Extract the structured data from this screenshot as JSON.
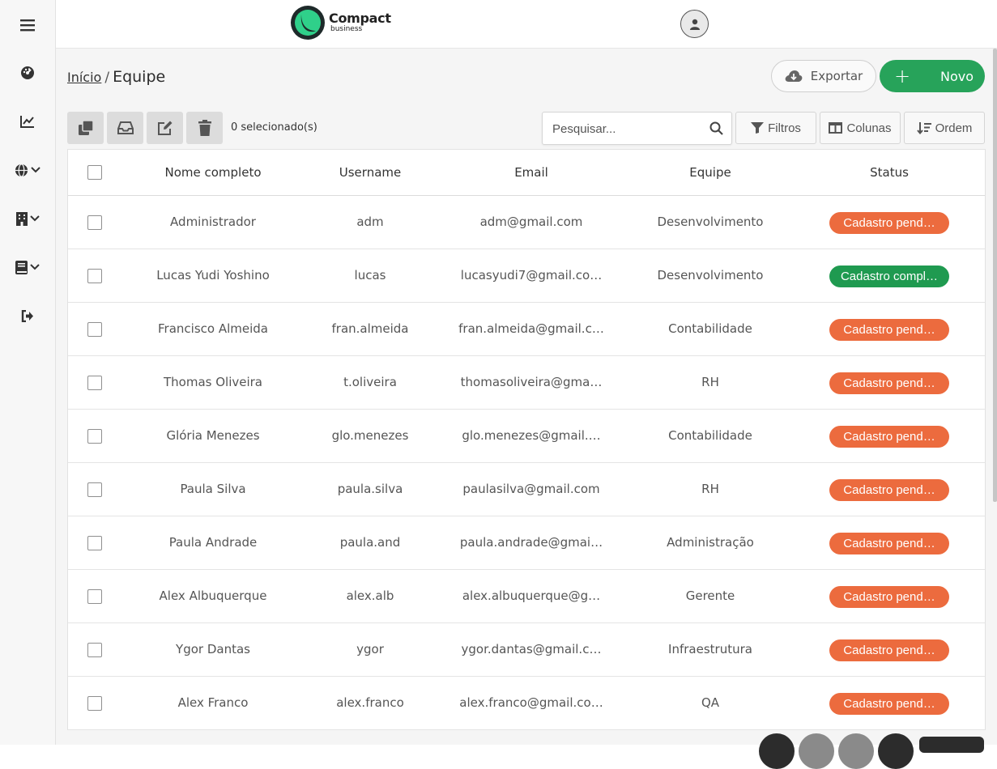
{
  "sidebar": {
    "items": [
      {
        "name": "menu-icon"
      },
      {
        "name": "dashboard-icon"
      },
      {
        "name": "chart-icon"
      },
      {
        "name": "globe-icon",
        "chevron": true
      },
      {
        "name": "building-icon",
        "chevron": true
      },
      {
        "name": "book-icon",
        "chevron": true
      },
      {
        "name": "logout-icon"
      }
    ]
  },
  "header": {
    "logo_title": "Compact",
    "logo_sub": "business"
  },
  "breadcrumb": {
    "home": "Início",
    "sep": "/",
    "current": "Equipe"
  },
  "actions": {
    "export_label": "Exportar",
    "new_label": "Novo"
  },
  "toolbar": {
    "selected_text": "0 selecionado(s)",
    "search_placeholder": "Pesquisar...",
    "filters_label": "Filtros",
    "columns_label": "Colunas",
    "order_label": "Ordem"
  },
  "table": {
    "columns": [
      "Nome completo",
      "Username",
      "Email",
      "Equipe",
      "Status"
    ],
    "rows": [
      {
        "name": "Administrador",
        "username": "adm",
        "email": "adm@gmail.com",
        "team": "Desenvolvimento",
        "status": "Cadastro pend…",
        "status_type": "pending"
      },
      {
        "name": "Lucas Yudi Yoshino",
        "username": "lucas",
        "email": "lucasyudi7@gmail.co…",
        "team": "Desenvolvimento",
        "status": "Cadastro compl…",
        "status_type": "complete"
      },
      {
        "name": "Francisco Almeida",
        "username": "fran.almeida",
        "email": "fran.almeida@gmail.c…",
        "team": "Contabilidade",
        "status": "Cadastro pend…",
        "status_type": "pending"
      },
      {
        "name": "Thomas Oliveira",
        "username": "t.oliveira",
        "email": "thomasoliveira@gma…",
        "team": "RH",
        "status": "Cadastro pend…",
        "status_type": "pending"
      },
      {
        "name": "Glória Menezes",
        "username": "glo.menezes",
        "email": "glo.menezes@gmail.…",
        "team": "Contabilidade",
        "status": "Cadastro pend…",
        "status_type": "pending"
      },
      {
        "name": "Paula Silva",
        "username": "paula.silva",
        "email": "paulasilva@gmail.com",
        "team": "RH",
        "status": "Cadastro pend…",
        "status_type": "pending"
      },
      {
        "name": "Paula Andrade",
        "username": "paula.and",
        "email": "paula.andrade@gmai…",
        "team": "Administração",
        "status": "Cadastro pend…",
        "status_type": "pending"
      },
      {
        "name": "Alex Albuquerque",
        "username": "alex.alb",
        "email": "alex.albuquerque@g…",
        "team": "Gerente",
        "status": "Cadastro pend…",
        "status_type": "pending"
      },
      {
        "name": "Ygor Dantas",
        "username": "ygor",
        "email": "ygor.dantas@gmail.c…",
        "team": "Infraestrutura",
        "status": "Cadastro pend…",
        "status_type": "pending"
      },
      {
        "name": "Alex Franco",
        "username": "alex.franco",
        "email": "alex.franco@gmail.co…",
        "team": "QA",
        "status": "Cadastro pend…",
        "status_type": "pending"
      }
    ]
  },
  "colors": {
    "pending": "#ec6b3e",
    "complete": "#1f9a50",
    "primary": "#27a35a",
    "logo_ring": "#1e2a2a",
    "logo_fill": "#2fd08a"
  }
}
